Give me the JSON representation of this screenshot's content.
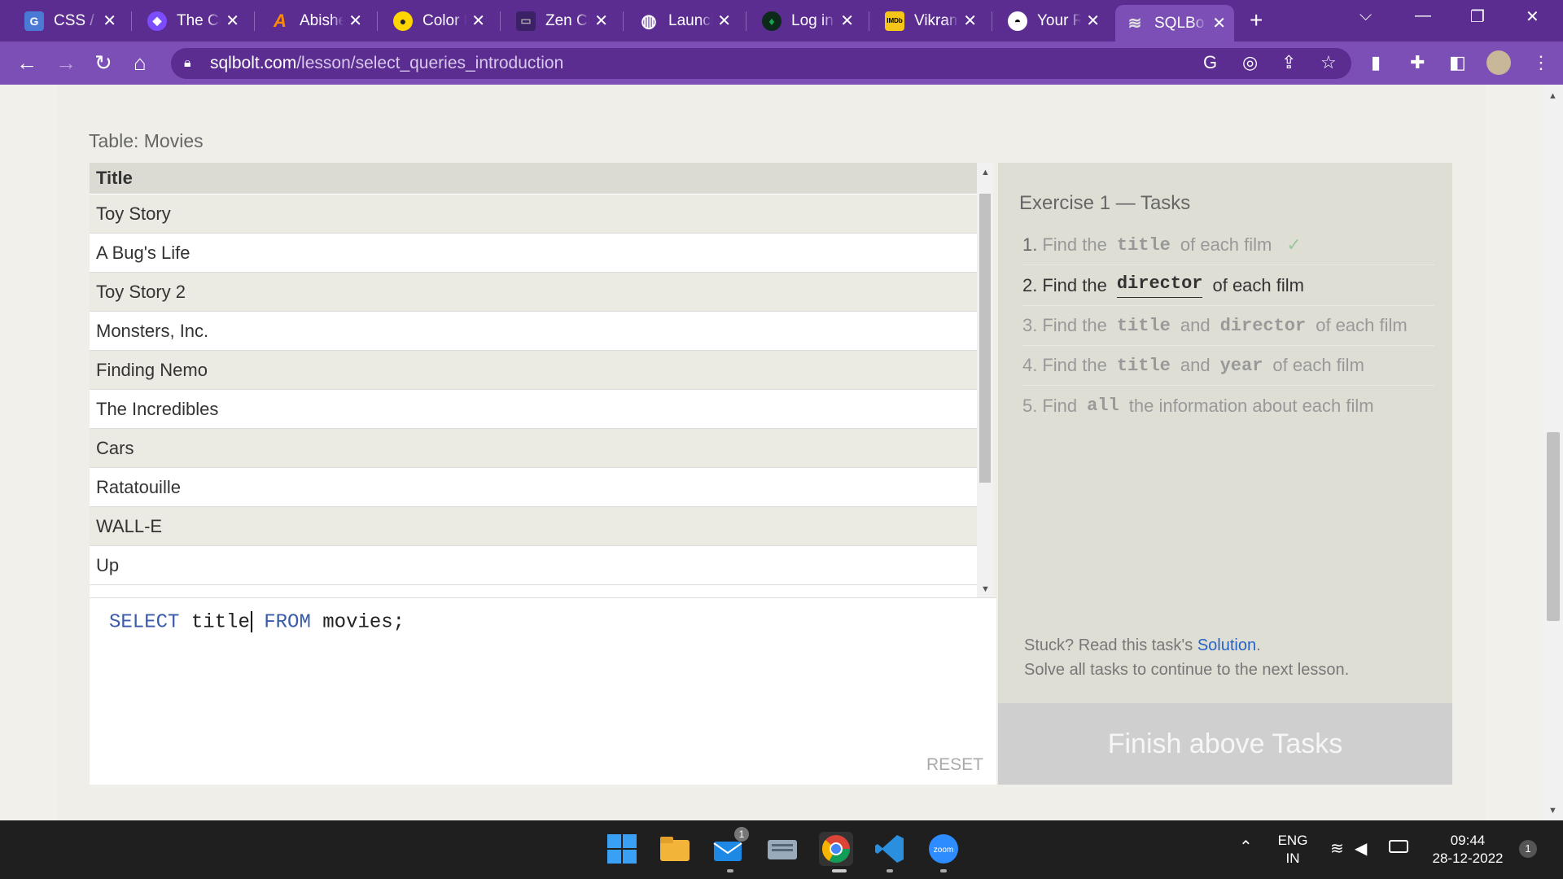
{
  "tabs": [
    {
      "label": "CSS / C",
      "favicon": "css-favicon-icon"
    },
    {
      "label": "The Co",
      "favicon": "shield-favicon-icon"
    },
    {
      "label": "Abishe",
      "favicon": "a-favicon-icon"
    },
    {
      "label": "Color F",
      "favicon": "color-favicon-icon"
    },
    {
      "label": "Zen Cl",
      "favicon": "zen-favicon-icon"
    },
    {
      "label": "Launch",
      "favicon": "globe-favicon-icon"
    },
    {
      "label": "Log in",
      "favicon": "mongodb-favicon-icon"
    },
    {
      "label": "Vikram",
      "favicon": "imdb-favicon-icon"
    },
    {
      "label": "Your R",
      "favicon": "github-favicon-icon"
    },
    {
      "label": "SQLBo",
      "favicon": "sqlbolt-favicon-icon",
      "active": true
    }
  ],
  "address_bar": {
    "host": "sqlbolt.com",
    "path": "/lesson/select_queries_introduction"
  },
  "table": {
    "caption": "Table: Movies",
    "header": "Title",
    "rows": [
      "Toy Story",
      "A Bug's Life",
      "Toy Story 2",
      "Monsters, Inc.",
      "Finding Nemo",
      "The Incredibles",
      "Cars",
      "Ratatouille",
      "WALL-E",
      "Up"
    ]
  },
  "editor": {
    "kw1": "SELECT",
    "col": "title",
    "kw2": "FROM",
    "rest": "movies;",
    "reset_label": "RESET"
  },
  "tasks": {
    "title": "Exercise 1 — Tasks",
    "items": [
      {
        "num": "1.",
        "pre": "Find the",
        "c1": "title",
        "post": "of each film",
        "check": "✓"
      },
      {
        "num": "2.",
        "pre": "Find the",
        "c1": "director",
        "post": "of each film"
      },
      {
        "num": "3.",
        "pre": "Find the",
        "c1": "title",
        "mid": "and",
        "c2": "director",
        "post": "of each film"
      },
      {
        "num": "4.",
        "pre": "Find the",
        "c1": "title",
        "mid": "and",
        "c2": "year",
        "post": "of each film"
      },
      {
        "num": "5.",
        "pre": "Find",
        "c1": "all",
        "post": "the information about each film"
      }
    ],
    "stuck_prefix": "Stuck? Read this task's",
    "solution_link": "Solution",
    "stuck_suffix": ".",
    "continue_text": "Solve all tasks to continue to the next lesson.",
    "finish_button": "Finish above Tasks"
  },
  "taskbar": {
    "lang_top": "ENG",
    "lang_bottom": "IN",
    "time": "09:44",
    "date": "28-12-2022",
    "notification_count": "1",
    "mail_badge": "1",
    "zoom_label": "zoom"
  }
}
